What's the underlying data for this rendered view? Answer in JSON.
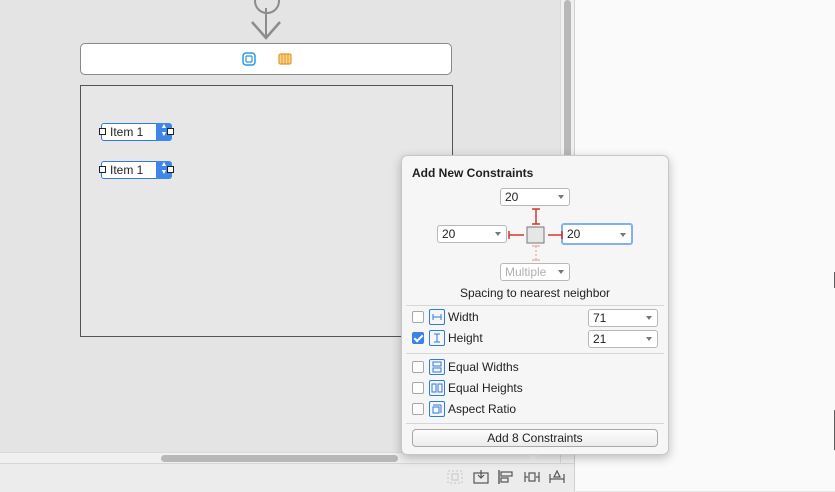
{
  "canvas": {
    "stepper_1_label": "Item 1",
    "stepper_2_label": "Item 1"
  },
  "popover": {
    "title": "Add New Constraints",
    "spacing": {
      "top": "20",
      "left": "20",
      "right": "20",
      "bottom": "Multiple",
      "caption": "Spacing to nearest neighbor"
    },
    "width": {
      "label": "Width",
      "checked": false,
      "value": "71"
    },
    "height": {
      "label": "Height",
      "checked": true,
      "value": "21"
    },
    "equal_widths": {
      "label": "Equal Widths",
      "checked": false
    },
    "equal_heights": {
      "label": "Equal Heights",
      "checked": false
    },
    "aspect_ratio": {
      "label": "Aspect Ratio",
      "checked": false
    },
    "add_button": "Add 8 Constraints"
  },
  "colors": {
    "accent": "#3b82e6",
    "constraint_red": "#d0392f",
    "storyboard_orange": "#f0a030"
  },
  "toolbar": {
    "icons": [
      "update-frames-icon",
      "embed-in-stack-icon",
      "align-icon",
      "add-constraints-icon",
      "resolve-issues-icon"
    ]
  }
}
